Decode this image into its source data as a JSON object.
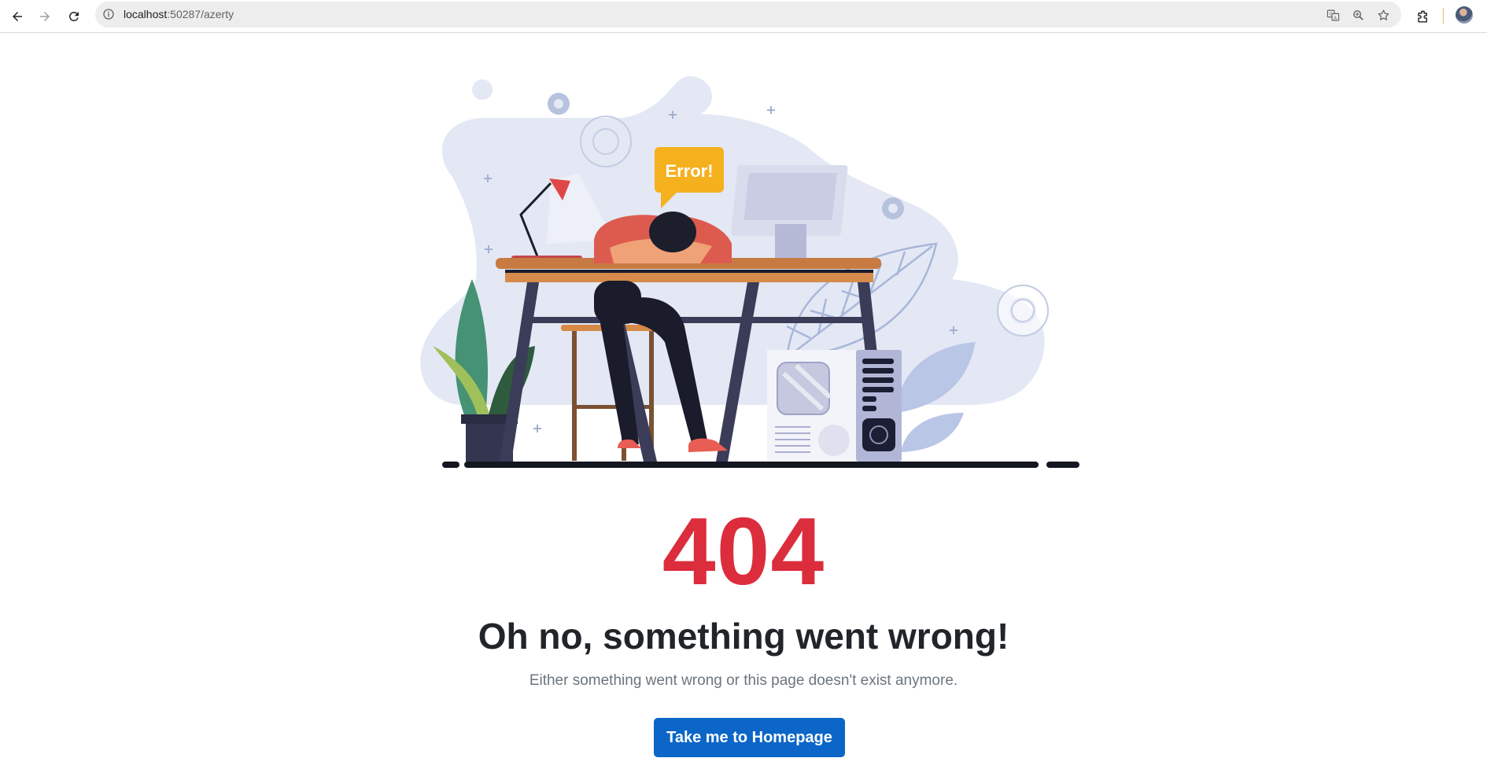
{
  "browser": {
    "url_host": "localhost",
    "url_rest": ":50287/azerty",
    "icons": [
      "back-icon",
      "forward-icon",
      "reload-icon",
      "site-info-icon",
      "translate-icon",
      "zoom-icon",
      "bookmark-star-icon",
      "extensions-icon",
      "profile-avatar"
    ]
  },
  "illustration": {
    "bubble_text": "Error!"
  },
  "error": {
    "code": "404",
    "title": "Oh no, something went wrong!",
    "message": "Either something went wrong or this page doesn't exist anymore.",
    "button_label": "Take me to Homepage"
  },
  "colors": {
    "error_red": "#dc2d3d",
    "button_blue": "#0b66c8",
    "bubble_yellow": "#f5b01d",
    "title_dark": "#212529",
    "muted_gray": "#6c757d"
  }
}
